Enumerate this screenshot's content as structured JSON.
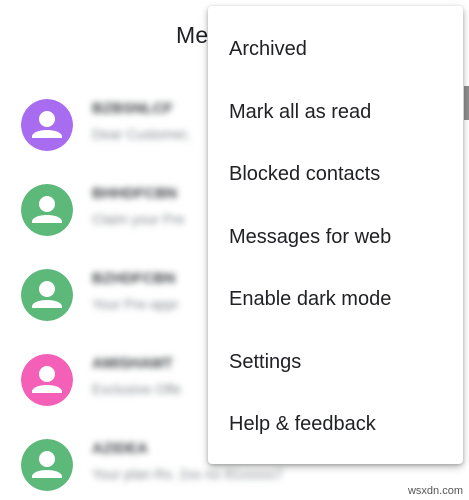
{
  "header": {
    "title": "Messages"
  },
  "conversations": [
    {
      "name": "BZBSNLCF",
      "snippet": "Dear Customer,",
      "avatar_color": "#a86cf0"
    },
    {
      "name": "BHHDFCBN",
      "snippet": "Claim your Pre",
      "avatar_color": "#5cb97a"
    },
    {
      "name": "BZHDFCBN",
      "snippet": "Your Pre-appr",
      "avatar_color": "#5cb97a"
    },
    {
      "name": "AMISHAMT",
      "snippet": "Exclusive Offe",
      "avatar_color": "#f45fb7"
    },
    {
      "name": "AZIDEA",
      "snippet": "Your plan Rs. 2xx no 81xxxxx7",
      "avatar_color": "#5cb97a"
    }
  ],
  "menu": {
    "items": [
      {
        "label": "Archived"
      },
      {
        "label": "Mark all as read"
      },
      {
        "label": "Blocked contacts"
      },
      {
        "label": "Messages for web"
      },
      {
        "label": "Enable dark mode"
      },
      {
        "label": "Settings"
      },
      {
        "label": "Help & feedback"
      }
    ]
  },
  "watermark": "wsxdn.com",
  "icons": {
    "avatar": "person-icon"
  }
}
